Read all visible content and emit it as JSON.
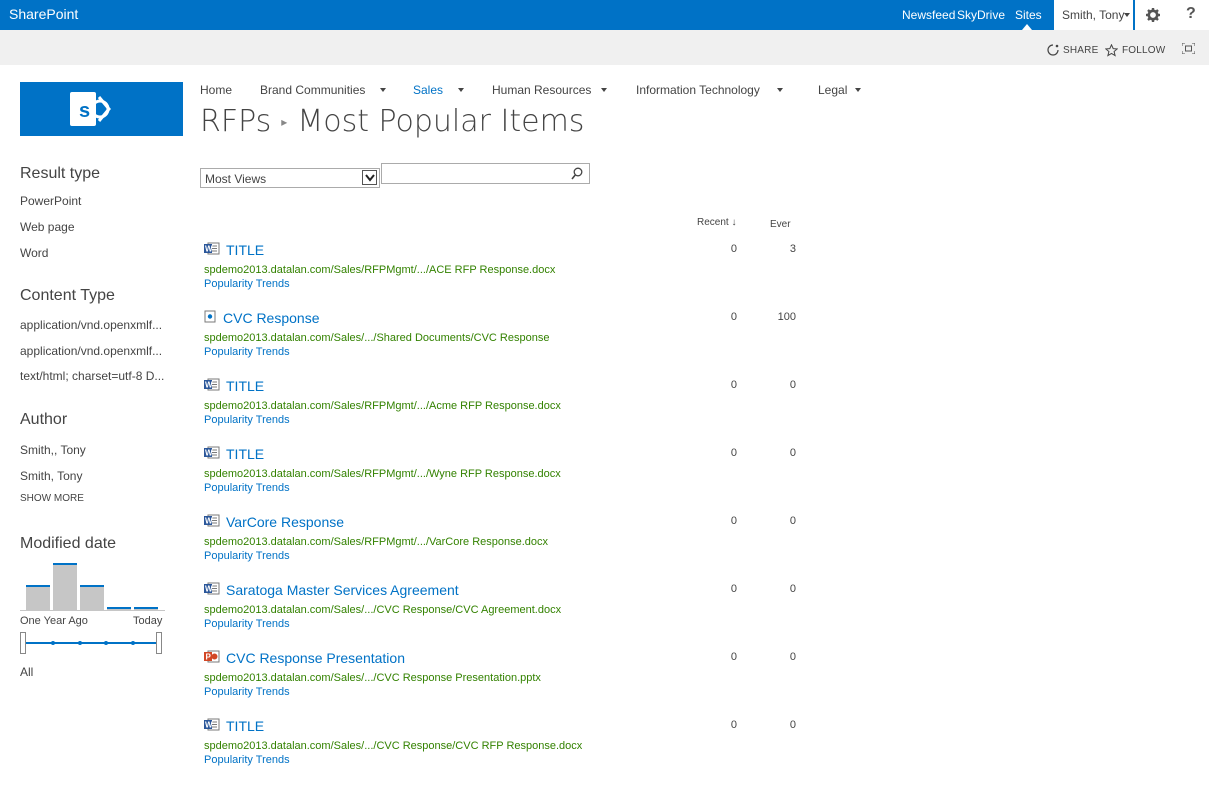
{
  "suite": {
    "brand": "SharePoint",
    "links": [
      "Newsfeed",
      "SkyDrive",
      "Sites"
    ],
    "user": "Smith, Tony"
  },
  "ribbon": {
    "share": "SHARE",
    "follow": "FOLLOW"
  },
  "topnav": [
    {
      "label": "Home"
    },
    {
      "label": "Brand Communities"
    },
    {
      "label": "Sales"
    },
    {
      "label": "Human Resources"
    },
    {
      "label": "Information Technology"
    },
    {
      "label": "Legal"
    }
  ],
  "title": {
    "site": "RFPs",
    "sep": "▸",
    "page": "Most Popular Items"
  },
  "refiners": {
    "result_type": {
      "heading": "Result type",
      "items": [
        "PowerPoint",
        "Web page",
        "Word"
      ]
    },
    "content_type": {
      "heading": "Content Type",
      "items": [
        "application/vnd.openxmlf...",
        "application/vnd.openxmlf...",
        "text/html; charset=utf-8 D..."
      ]
    },
    "author": {
      "heading": "Author",
      "items": [
        "Smith,, Tony",
        "Smith, Tony"
      ],
      "show_more": "SHOW MORE"
    },
    "modified": {
      "heading": "Modified date",
      "from": "One Year Ago",
      "to": "Today",
      "range": "All"
    }
  },
  "controls": {
    "sort_value": "Most Views",
    "search_value": ""
  },
  "columns": {
    "recent": "Recent",
    "ever": "Ever"
  },
  "results": [
    {
      "icon": "word",
      "title": "TITLE",
      "url": "spdemo2013.datalan.com/Sales/RFPMgmt/.../ACE RFP Response.docx",
      "pop": "Popularity Trends",
      "recent": "0",
      "ever": "3"
    },
    {
      "icon": "web",
      "title": "CVC Response",
      "url": "spdemo2013.datalan.com/Sales/.../Shared Documents/CVC Response",
      "pop": "Popularity Trends",
      "recent": "0",
      "ever": "100"
    },
    {
      "icon": "word",
      "title": "TITLE",
      "url": "spdemo2013.datalan.com/Sales/RFPMgmt/.../Acme RFP Response.docx",
      "pop": "Popularity Trends",
      "recent": "0",
      "ever": "0"
    },
    {
      "icon": "word",
      "title": "TITLE",
      "url": "spdemo2013.datalan.com/Sales/RFPMgmt/.../Wyne RFP Response.docx",
      "pop": "Popularity Trends",
      "recent": "0",
      "ever": "0"
    },
    {
      "icon": "word",
      "title": "VarCore Response",
      "url": "spdemo2013.datalan.com/Sales/RFPMgmt/.../VarCore Response.docx",
      "pop": "Popularity Trends",
      "recent": "0",
      "ever": "0"
    },
    {
      "icon": "word",
      "title": "Saratoga Master Services Agreement",
      "url": "spdemo2013.datalan.com/Sales/.../CVC Response/CVC Agreement.docx",
      "pop": "Popularity Trends",
      "recent": "0",
      "ever": "0"
    },
    {
      "icon": "powerpoint",
      "title": "CVC Response Presentation",
      "url": "spdemo2013.datalan.com/Sales/.../CVC Response Presentation.pptx",
      "pop": "Popularity Trends",
      "recent": "0",
      "ever": "0"
    },
    {
      "icon": "word",
      "title": "TITLE",
      "url": "spdemo2013.datalan.com/Sales/.../CVC Response/CVC RFP Response.docx",
      "pop": "Popularity Trends",
      "recent": "0",
      "ever": "0"
    }
  ],
  "colors": {
    "brand_blue": "#0072c6",
    "url_green": "#338200",
    "ribbon_gray": "#f0f0f0"
  }
}
